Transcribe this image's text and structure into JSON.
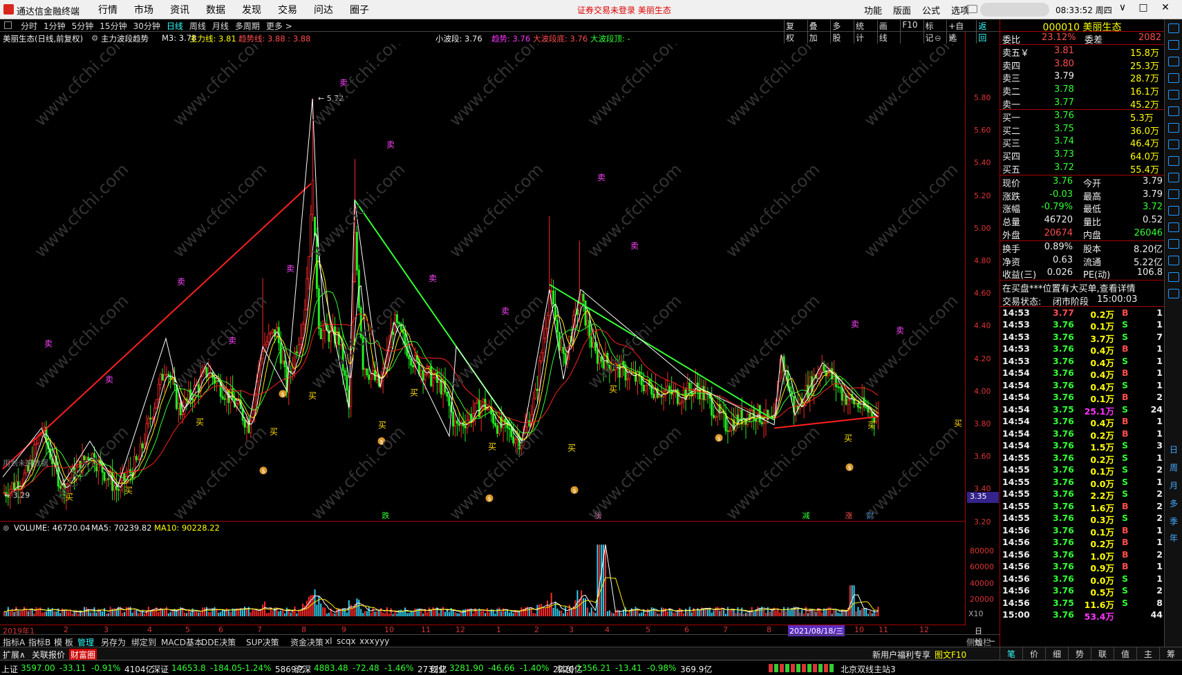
{
  "titlebar": {
    "app_name": "通达信金融终端",
    "menu": [
      "行情",
      "市场",
      "资讯",
      "数据",
      "发现",
      "交易",
      "问达",
      "圈子"
    ],
    "notice": "证券交易未登录  美丽生态",
    "right_menu": [
      "功能",
      "版面",
      "公式",
      "选项"
    ],
    "clock": "08:33:52 周四",
    "win_min": "∨",
    "win_restore": "□",
    "win_close": "✕"
  },
  "periods": [
    "分时",
    "1分钟",
    "5分钟",
    "15分钟",
    "30分钟",
    "日线",
    "周线",
    "月线",
    "多周期",
    "更多 >"
  ],
  "period_active": "日线",
  "chart_tools": [
    "复权",
    "叠加",
    "多股",
    "统计",
    "画线",
    "F10",
    "标记",
    "+自选",
    "返回"
  ],
  "chart_info": {
    "name": "美丽生态(日线,前复权)",
    "indicator": "主力波段趋势",
    "m3": "M3: 3.78",
    "main_line": "主力线: 3.81",
    "trend_line": "趋势线: 3.88 : 3.88",
    "small_wave": "小波段: 3.76",
    "trend": "趋势: 3.76",
    "big_low": "大波段底: 3.76",
    "big_top": "大波段顶: -"
  },
  "price_axis": [
    "5.80",
    "5.60",
    "5.40",
    "5.20",
    "5.00",
    "4.80",
    "4.60",
    "4.40",
    "4.20",
    "4.00",
    "3.80",
    "3.60",
    "3.40",
    "3.20"
  ],
  "price_current": "3.35",
  "chart_labels": {
    "high": "5.72",
    "low": "3.29",
    "future_note": "用到未来数据",
    "buy": "买",
    "sell": "卖"
  },
  "bottom_marks": [
    "跌",
    "榜",
    "减",
    "涨",
    "财"
  ],
  "volume_info": {
    "volume": "VOLUME: 46720.04",
    "ma5": "MA5: 70239.82",
    "ma10": "MA10: 90228.22"
  },
  "volume_axis": [
    "80000",
    "60000",
    "40000",
    "20000",
    "X10"
  ],
  "date_axis": {
    "year": "2019年1",
    "months": [
      "2",
      "3",
      "4",
      "5",
      "6",
      "7",
      "8",
      "9",
      "10",
      "11",
      "12",
      "1",
      "2",
      "3",
      "4",
      "5",
      "6",
      "7",
      "8",
      "10",
      "11",
      "12"
    ],
    "highlight": "2021/08/18/三",
    "right_label": "日线"
  },
  "indicator_tabs": [
    "指标A",
    "指标B",
    "模 板",
    "管理",
    "另存为",
    "绑定到",
    "MACD基本",
    "DDE决策",
    "SUP决策",
    "资金决策",
    "xl",
    "scqx",
    "xxx",
    "yyy"
  ],
  "tabs2": [
    "扩展∧",
    "关联报价",
    "财富圈"
  ],
  "promo": [
    "新用户福利专享",
    "图文F10",
    "侧边栏 ≪"
  ],
  "right_tabs": [
    "笔",
    "价",
    "细",
    "势",
    "联",
    "值",
    "主",
    "筹"
  ],
  "quote": {
    "code": "000010",
    "name": "美丽生态",
    "weibi_label": "委比",
    "weibi": "23.12%",
    "weicha_label": "委差",
    "weicha": "2082",
    "asks": [
      {
        "label": "卖五￥",
        "price": "3.81",
        "vol": "15.8万"
      },
      {
        "label": "卖四",
        "price": "3.80",
        "vol": "25.3万"
      },
      {
        "label": "卖三",
        "price": "3.79",
        "vol": "28.7万"
      },
      {
        "label": "卖二",
        "price": "3.78",
        "vol": "16.1万"
      },
      {
        "label": "卖一",
        "price": "3.77",
        "vol": "45.2万"
      }
    ],
    "bids": [
      {
        "label": "买一",
        "price": "3.76",
        "vol": "5.3万"
      },
      {
        "label": "买二",
        "price": "3.75",
        "vol": "36.0万"
      },
      {
        "label": "买三",
        "price": "3.74",
        "vol": "46.4万"
      },
      {
        "label": "买四",
        "price": "3.73",
        "vol": "64.0万"
      },
      {
        "label": "买五",
        "price": "3.72",
        "vol": "55.4万"
      }
    ],
    "stats1": [
      {
        "l1": "现价",
        "v1": "3.76",
        "l2": "今开",
        "v2": "3.79"
      },
      {
        "l1": "涨跌",
        "v1": "-0.03",
        "l2": "最高",
        "v2": "3.79"
      },
      {
        "l1": "涨幅",
        "v1": "-0.79%",
        "l2": "最低",
        "v2": "3.72"
      },
      {
        "l1": "总量",
        "v1": "46720",
        "l2": "量比",
        "v2": "0.52"
      },
      {
        "l1": "外盘",
        "v1": "20674",
        "l2": "内盘",
        "v2": "26046"
      }
    ],
    "stats2": [
      {
        "l1": "换手",
        "v1": "0.89%",
        "l2": "股本",
        "v2": "8.20亿"
      },
      {
        "l1": "净资",
        "v1": "0.63",
        "l2": "流通",
        "v2": "5.22亿"
      },
      {
        "l1": "收益(三)",
        "v1": "0.026",
        "l2": "PE(动)",
        "v2": "106.8"
      }
    ],
    "notice": "在买盘***位置有大买单,查看详情",
    "state_label": "交易状态:",
    "state": "闭市阶段",
    "state_time": "15:00:03"
  },
  "ticks": [
    {
      "t": "14:53",
      "p": "3.77",
      "v": "0.2万",
      "s": "B",
      "n": "1"
    },
    {
      "t": "14:53",
      "p": "3.76",
      "v": "0.1万",
      "s": "S",
      "n": "1"
    },
    {
      "t": "14:53",
      "p": "3.76",
      "v": "3.7万",
      "s": "S",
      "n": "7"
    },
    {
      "t": "14:53",
      "p": "3.76",
      "v": "0.4万",
      "s": "B",
      "n": "1"
    },
    {
      "t": "14:53",
      "p": "3.76",
      "v": "0.4万",
      "s": "S",
      "n": "1"
    },
    {
      "t": "14:54",
      "p": "3.76",
      "v": "0.4万",
      "s": "B",
      "n": "1"
    },
    {
      "t": "14:54",
      "p": "3.76",
      "v": "0.4万",
      "s": "S",
      "n": "1"
    },
    {
      "t": "14:54",
      "p": "3.76",
      "v": "0.1万",
      "s": "B",
      "n": "2"
    },
    {
      "t": "14:54",
      "p": "3.75",
      "v": "25.1万",
      "s": "S",
      "n": "24"
    },
    {
      "t": "14:54",
      "p": "3.76",
      "v": "0.4万",
      "s": "B",
      "n": "1"
    },
    {
      "t": "14:54",
      "p": "3.76",
      "v": "0.2万",
      "s": "B",
      "n": "1"
    },
    {
      "t": "14:54",
      "p": "3.76",
      "v": "1.5万",
      "s": "S",
      "n": "3"
    },
    {
      "t": "14:55",
      "p": "3.76",
      "v": "0.2万",
      "s": "S",
      "n": "1"
    },
    {
      "t": "14:55",
      "p": "3.76",
      "v": "0.1万",
      "s": "S",
      "n": "2"
    },
    {
      "t": "14:55",
      "p": "3.76",
      "v": "0.0万",
      "s": "S",
      "n": "1"
    },
    {
      "t": "14:55",
      "p": "3.76",
      "v": "2.2万",
      "s": "S",
      "n": "2"
    },
    {
      "t": "14:55",
      "p": "3.76",
      "v": "1.6万",
      "s": "B",
      "n": "2"
    },
    {
      "t": "14:55",
      "p": "3.76",
      "v": "0.3万",
      "s": "S",
      "n": "2"
    },
    {
      "t": "14:56",
      "p": "3.76",
      "v": "0.1万",
      "s": "B",
      "n": "1"
    },
    {
      "t": "14:56",
      "p": "3.76",
      "v": "0.2万",
      "s": "B",
      "n": "1"
    },
    {
      "t": "14:56",
      "p": "3.76",
      "v": "1.0万",
      "s": "B",
      "n": "2"
    },
    {
      "t": "14:56",
      "p": "3.76",
      "v": "0.9万",
      "s": "B",
      "n": "1"
    },
    {
      "t": "14:56",
      "p": "3.76",
      "v": "0.0万",
      "s": "S",
      "n": "1"
    },
    {
      "t": "14:56",
      "p": "3.76",
      "v": "0.5万",
      "s": "S",
      "n": "2"
    },
    {
      "t": "14:56",
      "p": "3.75",
      "v": "11.6万",
      "s": "S",
      "n": "8"
    },
    {
      "t": "15:00",
      "p": "3.76",
      "v": "53.4万",
      "s": "",
      "n": "44"
    }
  ],
  "sidebar_text": [
    "日",
    "周",
    "月",
    "多",
    "季",
    "年"
  ],
  "status": [
    {
      "name": "上证",
      "val": "3597.00",
      "chg": "-33.11",
      "pct": "-0.91%",
      "amt": "4104亿"
    },
    {
      "name": "深证",
      "val": "14653.8",
      "chg": "-184.05",
      "pct": "-1.24%",
      "amt": "5869亿"
    },
    {
      "name": "沪深",
      "val": "4883.48",
      "chg": "-72.48",
      "pct": "-1.46%",
      "amt": "2732亿"
    },
    {
      "name": "创业",
      "val": "3281.90",
      "chg": "-46.66",
      "pct": "-1.40%",
      "amt": "2220亿"
    },
    {
      "name": "科创",
      "val": "1356.21",
      "chg": "-13.41",
      "pct": "-0.98%",
      "amt": "369.9亿"
    }
  ],
  "server": "北京双线主站3",
  "colors": {
    "up": "#ff4d4d",
    "down": "#33ff33",
    "ma_yellow": "#ffee00",
    "trend_red": "#ff2020",
    "trend_green": "#33ff33",
    "axis": "#aa0000"
  }
}
